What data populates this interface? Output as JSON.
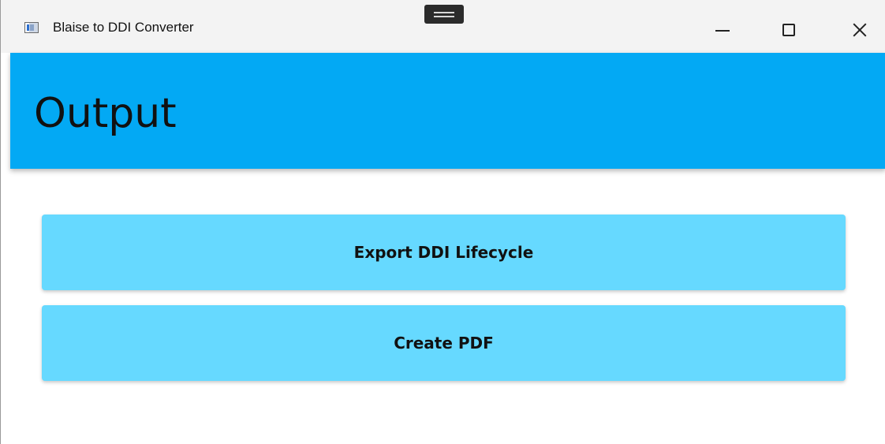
{
  "window": {
    "title": "Blaise to DDI Converter",
    "icons": {
      "app": "app-window-icon",
      "minimize": "minimize-icon",
      "maximize": "maximize-icon",
      "close": "close-icon",
      "drag": "drag-handle-icon"
    }
  },
  "header": {
    "title": "Output",
    "color": "#03a9f4"
  },
  "actions": {
    "export_label": "Export DDI Lifecycle",
    "pdf_label": "Create PDF",
    "button_color": "#66d9ff"
  }
}
